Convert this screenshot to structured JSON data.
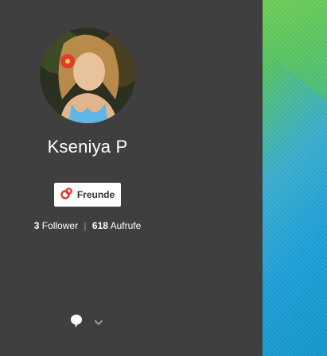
{
  "profile": {
    "name": "Kseniya P"
  },
  "actions": {
    "friends_label": "Freunde"
  },
  "stats": {
    "followers_count": "3",
    "followers_label": "Follower",
    "separator": "|",
    "views_count": "618",
    "views_label": "Aufrufe"
  },
  "icons": {
    "friends": "circles-icon",
    "comment": "speech-bubble-icon",
    "expand": "chevron-down-icon"
  },
  "colors": {
    "sidebar_bg": "#3f3f3f",
    "button_bg": "#ffffff",
    "brand_red": "#e0352b"
  }
}
